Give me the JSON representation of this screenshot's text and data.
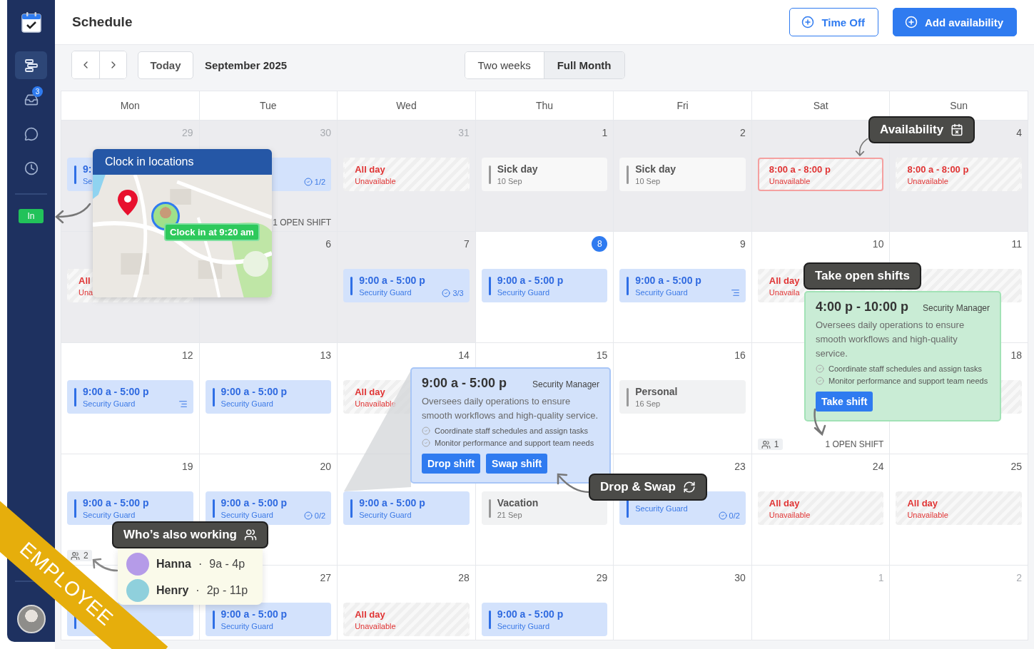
{
  "sidebar": {
    "items": [
      {
        "kind": "schedule",
        "selected": true
      },
      {
        "kind": "inbox",
        "selected": false,
        "badge": "3"
      },
      {
        "kind": "chat",
        "selected": false
      },
      {
        "kind": "clock",
        "selected": false
      }
    ],
    "clock_button": "In"
  },
  "header": {
    "title": "Schedule",
    "buttons": [
      {
        "label": "Time Off",
        "kind": "outline"
      },
      {
        "label": "Add availability",
        "kind": "primary"
      }
    ]
  },
  "toolbar": {
    "today": "Today",
    "period": "September 2025",
    "views": [
      {
        "label": "Two weeks",
        "selected": false
      },
      {
        "label": "Full Month",
        "selected": true
      }
    ]
  },
  "weekdays": [
    "Mon",
    "Tue",
    "Wed",
    "Thu",
    "Fri",
    "Sat",
    "Sun"
  ],
  "weeks": [
    {
      "days": [
        {
          "day": "29",
          "muted": true,
          "today": false,
          "past": true,
          "events": [
            {
              "kind": "shift",
              "time": "9:",
              "role": "Se"
            }
          ]
        },
        {
          "day": "30",
          "muted": true,
          "today": false,
          "past": true,
          "events": [
            {
              "kind": "shift",
              "badge": "1/2",
              "notes": false
            }
          ],
          "open_shift": "1 OPEN SHIFT"
        },
        {
          "day": "31",
          "muted": true,
          "today": false,
          "past": true,
          "events": [
            {
              "kind": "unavailable",
              "time": "All day",
              "note": "Unavailable",
              "highlighted": false
            }
          ]
        },
        {
          "day": "1",
          "muted": false,
          "today": false,
          "past": true,
          "events": [
            {
              "kind": "timeoff",
              "title": "Sick day",
              "date": "10 Sep"
            }
          ]
        },
        {
          "day": "2",
          "muted": false,
          "today": false,
          "past": true,
          "events": [
            {
              "kind": "timeoff",
              "title": "Sick day",
              "date": "10 Sep"
            }
          ]
        },
        {
          "past": true,
          "events": [
            {
              "kind": "unavailable",
              "time": "8:00 a - 8:00 p",
              "note": "Unavailable",
              "highlighted": true
            }
          ]
        },
        {
          "day": "4",
          "muted": false,
          "today": false,
          "past": true,
          "events": [
            {
              "kind": "unavailable",
              "time": "8:00 a - 8:00 p",
              "note": "Unavailable",
              "highlighted": false
            }
          ]
        }
      ]
    },
    {
      "days": [
        {
          "past": true,
          "events": [
            {
              "kind": "unavailable",
              "time": "All",
              "note": "Una",
              "highlighted": false
            }
          ]
        },
        {
          "day": "6",
          "muted": false,
          "today": false,
          "past": true
        },
        {
          "day": "7",
          "muted": false,
          "today": false,
          "past": true,
          "events": [
            {
              "kind": "shift",
              "time": "9:00 a - 5:00 p",
              "role": "Security Guard",
              "badge": "3/3",
              "notes": false
            }
          ]
        },
        {
          "day": "8",
          "muted": false,
          "today": true,
          "past": false,
          "events": [
            {
              "kind": "shift",
              "time": "9:00 a - 5:00 p",
              "role": "Security Guard",
              "notes": false
            }
          ]
        },
        {
          "day": "9",
          "muted": false,
          "today": false,
          "past": false,
          "events": [
            {
              "kind": "shift",
              "time": "9:00 a - 5:00 p",
              "role": "Security Guard",
              "notes": true
            }
          ]
        },
        {
          "day": "10",
          "muted": false,
          "today": false,
          "past": false,
          "events": [
            {
              "kind": "unavailable",
              "time": "All day",
              "note": "Unavaila",
              "highlighted": false
            }
          ]
        },
        {
          "day": "11",
          "muted": false,
          "today": false,
          "past": false,
          "events": [
            {
              "kind": "unavailable",
              "highlighted": false
            }
          ]
        }
      ]
    },
    {
      "days": [
        {
          "day": "12",
          "muted": false,
          "today": false,
          "past": false,
          "events": [
            {
              "kind": "shift",
              "time": "9:00 a - 5:00 p",
              "role": "Security Guard",
              "notes": true
            }
          ]
        },
        {
          "day": "13",
          "muted": false,
          "today": false,
          "past": false,
          "events": [
            {
              "kind": "shift",
              "time": "9:00 a - 5:00 p",
              "role": "Security Guard",
              "notes": false
            }
          ]
        },
        {
          "day": "14",
          "muted": false,
          "today": false,
          "past": false,
          "events": [
            {
              "kind": "unavailable",
              "time": "All day",
              "note": "Unavailable",
              "highlighted": false
            }
          ]
        },
        {
          "day": "15",
          "muted": false,
          "today": false,
          "past": false
        },
        {
          "day": "16",
          "muted": false,
          "today": false,
          "past": false,
          "events": [
            {
              "kind": "timeoff",
              "title": "Personal",
              "date": "16 Sep"
            }
          ]
        },
        {
          "past": false,
          "people": "1",
          "open_shift": "1 OPEN SHIFT"
        },
        {
          "day": "18",
          "muted": false,
          "today": false,
          "past": false,
          "events": [
            {
              "kind": "unavailable",
              "highlighted": false
            }
          ]
        }
      ]
    },
    {
      "days": [
        {
          "day": "19",
          "muted": false,
          "today": false,
          "past": false,
          "events": [
            {
              "kind": "shift",
              "time": "9:00 a - 5:00 p",
              "role": "Security Guard",
              "notes": false
            }
          ],
          "people": "2"
        },
        {
          "day": "20",
          "muted": false,
          "today": false,
          "past": false,
          "events": [
            {
              "kind": "shift",
              "time": "9:00 a - 5:00 p",
              "role": "Security Guard",
              "badge": "0/2",
              "notes": false
            }
          ]
        },
        {
          "past": false,
          "events": [
            {
              "kind": "shift",
              "time": "9:00 a - 5:00 p",
              "role": "Security Guard",
              "notes": false
            }
          ]
        },
        {
          "past": false,
          "events": [
            {
              "kind": "timeoff",
              "title": "Vacation",
              "date": "21 Sep"
            }
          ]
        },
        {
          "day": "23",
          "muted": false,
          "today": false,
          "past": false,
          "events": [
            {
              "kind": "shift",
              "role": "Security Guard",
              "badge": "0/2",
              "notes": false
            }
          ]
        },
        {
          "day": "24",
          "muted": false,
          "today": false,
          "past": false,
          "events": [
            {
              "kind": "unavailable",
              "time": "All day",
              "note": "Unavailable",
              "highlighted": false
            }
          ]
        },
        {
          "day": "25",
          "muted": false,
          "today": false,
          "past": false,
          "events": [
            {
              "kind": "unavailable",
              "time": "All day",
              "note": "Unavailable",
              "highlighted": false
            }
          ]
        }
      ]
    },
    {
      "days": [
        {
          "past": false,
          "events": [
            {
              "kind": "shift",
              "notes": false
            }
          ]
        },
        {
          "day": "27",
          "muted": false,
          "today": false,
          "past": false,
          "events": [
            {
              "kind": "shift",
              "time": "9:00 a - 5:00 p",
              "role": "Security Guard",
              "notes": false
            }
          ]
        },
        {
          "day": "28",
          "muted": false,
          "today": false,
          "past": false,
          "events": [
            {
              "kind": "unavailable",
              "time": "All day",
              "note": "Unavailable",
              "highlighted": false
            }
          ]
        },
        {
          "day": "29",
          "muted": false,
          "today": false,
          "past": false,
          "events": [
            {
              "kind": "shift",
              "time": "9:00 a - 5:00 p",
              "role": "Security Guard",
              "notes": false
            }
          ]
        },
        {
          "day": "30",
          "muted": false,
          "today": false,
          "past": false
        },
        {
          "day": "1",
          "muted": true,
          "today": false,
          "past": false
        },
        {
          "day": "2",
          "muted": true,
          "today": false,
          "past": false
        }
      ]
    }
  ],
  "clock_in_card": {
    "title": "Clock in locations",
    "status": "Clock in at 9:20 am"
  },
  "availability_tag": "Availability",
  "open_shift_tag": "Take open shifts",
  "open_shift_card": {
    "time": "4:00 p - 10:00 p",
    "role": "Security Manager",
    "description": "Oversees daily operations to ensure smooth workflows and high-quality service.",
    "tasks": [
      "Coordinate staff schedules and assign tasks",
      "Monitor performance and support team needs"
    ],
    "buttons": [
      "Take shift"
    ]
  },
  "shift_popup": {
    "time": "9:00 a - 5:00 p",
    "role": "Security Manager",
    "description": "Oversees daily operations to ensure smooth workflows and high-quality service.",
    "tasks": [
      "Coordinate staff schedules and assign tasks",
      "Monitor performance and support team needs"
    ],
    "buttons": [
      "Drop shift",
      "Swap shift"
    ]
  },
  "swap_tag": "Drop & Swap",
  "coworkers_tag": "Who’s also working",
  "coworkers": [
    {
      "name": "Hanna",
      "separator": "·",
      "hours": "9a - 4p",
      "color": "#b59be8"
    },
    {
      "name": "Henry",
      "separator": "·",
      "hours": "2p - 11p",
      "color": "#8fd0dc"
    }
  ],
  "ribbon": "EMPLOYEE"
}
